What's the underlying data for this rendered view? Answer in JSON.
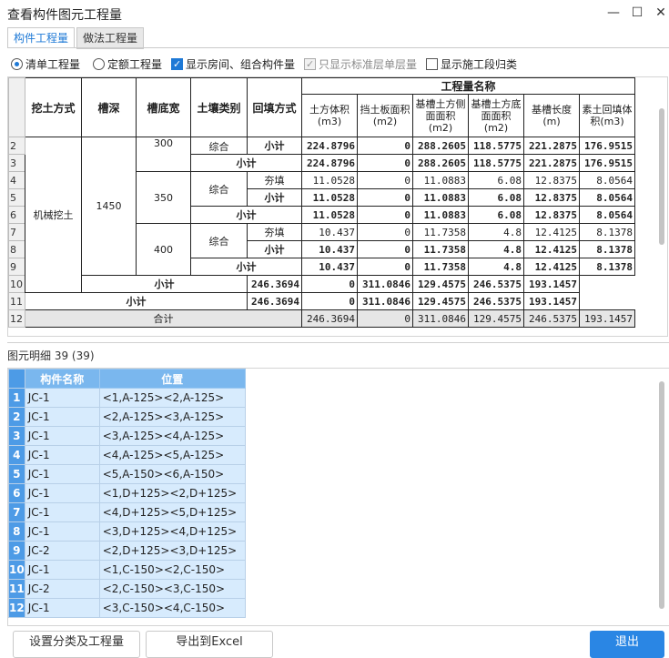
{
  "window": {
    "title": "查看构件图元工程量",
    "minimize": "—",
    "maximize": "☐",
    "close": "✕"
  },
  "tabs": [
    {
      "label": "构件工程量",
      "active": true
    },
    {
      "label": "做法工程量",
      "active": false
    }
  ],
  "options": {
    "radio_list": "清单工程量",
    "radio_quota": "定额工程量",
    "show_room": "显示房间、组合构件量",
    "only_standard": "只显示标准层单层量",
    "show_segment": "显示施工段归类"
  },
  "grid": {
    "headers": {
      "method": "挖土方式",
      "depth": "槽深",
      "width": "槽底宽",
      "soil": "土壤类别",
      "backfill": "回填方式",
      "group": "工程量名称",
      "cols": [
        "土方体积(m3)",
        "挡土板面积(m2)",
        "基槽土方侧面面积(m2)",
        "基槽土方底面面积(m2)",
        "基槽长度(m)",
        "素土回填体积(m3)"
      ]
    },
    "row_numbers": [
      "2",
      "3",
      "4",
      "5",
      "6",
      "7",
      "8",
      "9",
      "10",
      "11",
      "12"
    ],
    "method_value": "机械挖土",
    "depth_value": "1450",
    "widths": [
      "300",
      "350",
      "400"
    ],
    "soil_zonghe": "综合",
    "backfill_hangtian": "夯填",
    "subtotal": "小计",
    "total": "合计",
    "values": {
      "r2": [
        "224.8796",
        "0",
        "288.2605",
        "118.5775",
        "221.2875",
        "176.9515"
      ],
      "r3": [
        "224.8796",
        "0",
        "288.2605",
        "118.5775",
        "221.2875",
        "176.9515"
      ],
      "r4": [
        "11.0528",
        "0",
        "11.0883",
        "6.08",
        "12.8375",
        "8.0564"
      ],
      "r5": [
        "11.0528",
        "0",
        "11.0883",
        "6.08",
        "12.8375",
        "8.0564"
      ],
      "r6": [
        "11.0528",
        "0",
        "11.0883",
        "6.08",
        "12.8375",
        "8.0564"
      ],
      "r7": [
        "10.437",
        "0",
        "11.7358",
        "4.8",
        "12.4125",
        "8.1378"
      ],
      "r8": [
        "10.437",
        "0",
        "11.7358",
        "4.8",
        "12.4125",
        "8.1378"
      ],
      "r9": [
        "10.437",
        "0",
        "11.7358",
        "4.8",
        "12.4125",
        "8.1378"
      ],
      "r10": [
        "246.3694",
        "0",
        "311.0846",
        "129.4575",
        "246.5375",
        "193.1457"
      ],
      "r11": [
        "246.3694",
        "0",
        "311.0846",
        "129.4575",
        "246.5375",
        "193.1457"
      ],
      "r12": [
        "246.3694",
        "0",
        "311.0846",
        "129.4575",
        "246.5375",
        "193.1457"
      ]
    }
  },
  "detail": {
    "label": "图元明细",
    "count": "39 (39)",
    "col_name": "构件名称",
    "col_pos": "位置",
    "rows": [
      {
        "n": "1",
        "name": "JC-1",
        "pos": "<1,A-125><2,A-125>"
      },
      {
        "n": "2",
        "name": "JC-1",
        "pos": "<2,A-125><3,A-125>"
      },
      {
        "n": "3",
        "name": "JC-1",
        "pos": "<3,A-125><4,A-125>"
      },
      {
        "n": "4",
        "name": "JC-1",
        "pos": "<4,A-125><5,A-125>"
      },
      {
        "n": "5",
        "name": "JC-1",
        "pos": "<5,A-150><6,A-150>"
      },
      {
        "n": "6",
        "name": "JC-1",
        "pos": "<1,D+125><2,D+125>"
      },
      {
        "n": "7",
        "name": "JC-1",
        "pos": "<4,D+125><5,D+125>"
      },
      {
        "n": "8",
        "name": "JC-1",
        "pos": "<3,D+125><4,D+125>"
      },
      {
        "n": "9",
        "name": "JC-2",
        "pos": "<2,D+125><3,D+125>"
      },
      {
        "n": "10",
        "name": "JC-1",
        "pos": "<1,C-150><2,C-150>"
      },
      {
        "n": "11",
        "name": "JC-2",
        "pos": "<2,C-150><3,C-150>"
      },
      {
        "n": "12",
        "name": "JC-1",
        "pos": "<3,C-150><4,C-150>"
      }
    ]
  },
  "buttons": {
    "settings": "设置分类及工程量",
    "export": "导出到Excel",
    "exit": "退出"
  }
}
